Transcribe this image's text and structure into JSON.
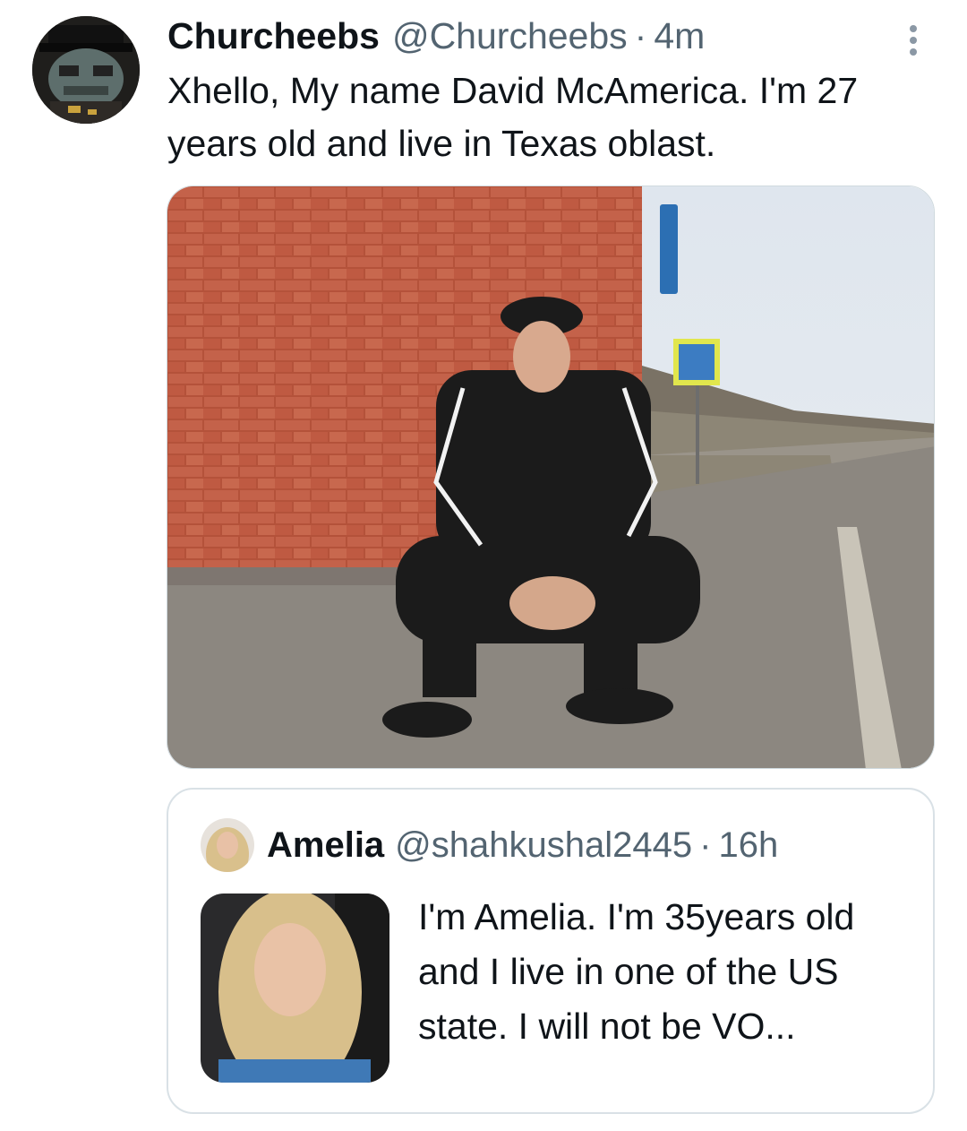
{
  "tweet": {
    "display_name": "Churcheebs",
    "handle": "@Churcheebs",
    "separator": "·",
    "time": "4m",
    "text": "Xhello, My name David McAmerica. I'm 27 years old and live in Texas oblast.",
    "more_icon": "more-vertical-icon"
  },
  "quoted_tweet": {
    "display_name": "Amelia",
    "handle": "@shahkushal2445",
    "separator": "·",
    "time": "16h",
    "text": "I'm Amelia. I'm 35years old and I live in one of the US state. I will not be VO..."
  },
  "colors": {
    "text_primary": "#0f1419",
    "text_secondary": "#536471",
    "border": "#cfd9de"
  }
}
